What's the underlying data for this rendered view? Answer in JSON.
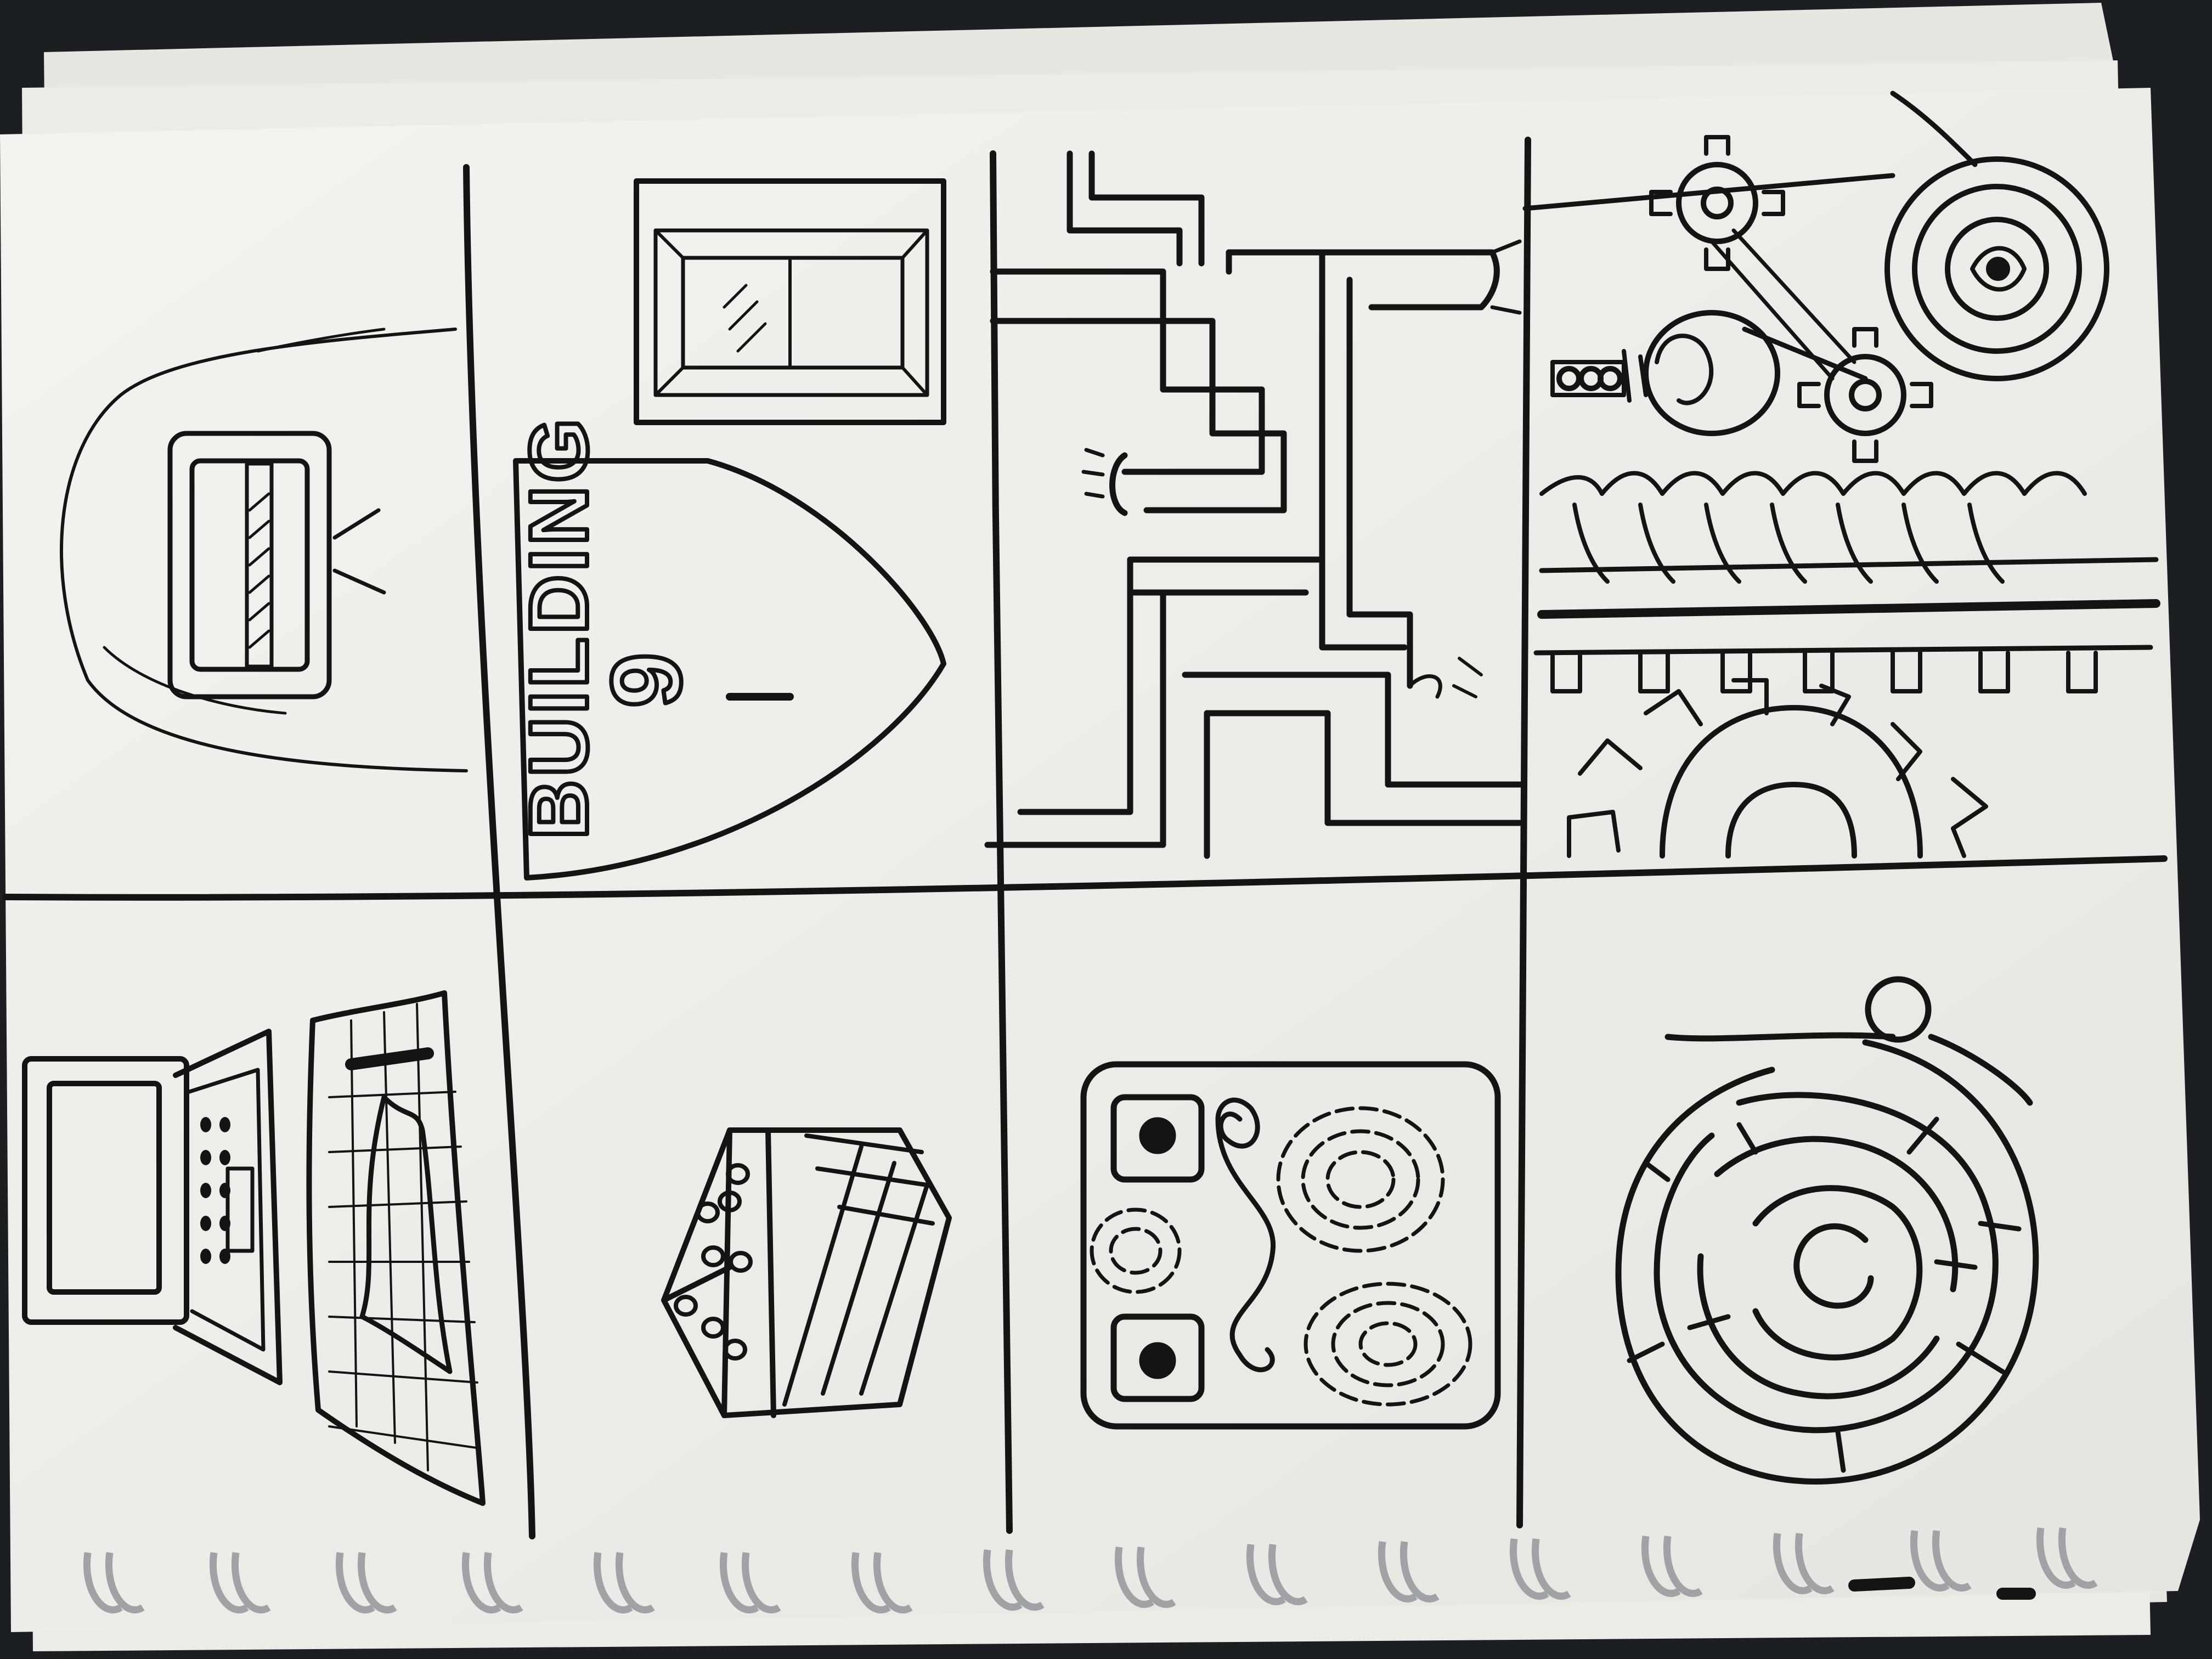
{
  "photo": {
    "subject": "photo-of-sketchbook-page",
    "orientation_note": "",
    "colors": {
      "background": "#1c1f21",
      "paper": "#f1f0ec",
      "paper_back": "#e9e8e3",
      "ink": "#141414",
      "spiral": "#9fa3a6"
    }
  },
  "panels": [
    {
      "id": "panel-1",
      "icon": "progress-bar-device-icon"
    },
    {
      "id": "panel-2",
      "icon": "building-sign-icon",
      "label": "BUILDING",
      "number": "9"
    },
    {
      "id": "panel-3",
      "icon": "pipes-icon"
    },
    {
      "id": "panel-4",
      "icon": "gears-eye-lightbulb-icon"
    },
    {
      "id": "panel-5",
      "icon": "laptop-and-map-icon"
    },
    {
      "id": "panel-6",
      "icon": "dice-box-icon"
    },
    {
      "id": "panel-7",
      "icon": "stovetop-icon"
    },
    {
      "id": "panel-8",
      "icon": "maze-icon"
    }
  ]
}
